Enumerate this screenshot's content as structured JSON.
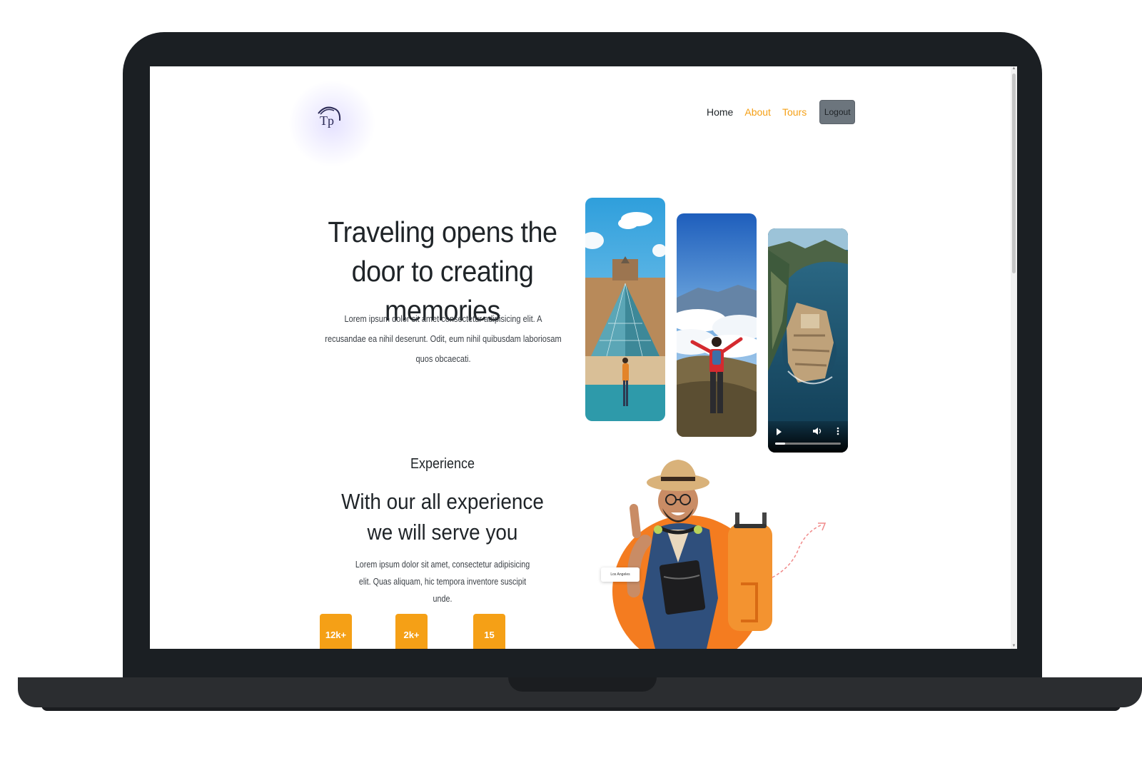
{
  "brand": {
    "logo_text": "Tp"
  },
  "nav": {
    "home": "Home",
    "about": "About",
    "tours": "Tours",
    "logout": "Logout"
  },
  "hero": {
    "title": "Traveling opens the door to creating memories",
    "text": "Lorem ipsum dolor sit amet consectetur adipisicing elit. A recusandae ea nihil deserunt. Odit, eum nihil quibusdam laboriosam quos obcaecati.",
    "images": [
      "louvre-pyramid-photo",
      "mountain-hiker-photo",
      "coastal-island-video"
    ],
    "video": {
      "progress": 0.15
    }
  },
  "experience": {
    "subtitle": "Experience",
    "title": "With our all experience we will serve you",
    "text": "Lorem ipsum dolor sit amet, consectetur adipisicing elit. Quas aliquam, hic tempora inventore suscipit unde.",
    "stats": [
      "12k+",
      "2k+",
      "15"
    ],
    "city_tag": "Los Angeles"
  },
  "colors": {
    "accent": "#f5a016",
    "orange_circle": "#f47c20",
    "logout_bg": "#6c757d",
    "text_dark": "#1f2428",
    "laptop_frame": "#1b1f23"
  }
}
